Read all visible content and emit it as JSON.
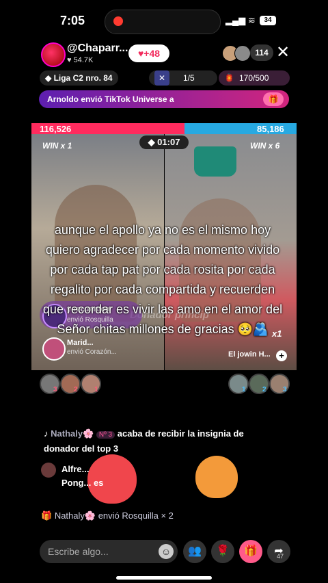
{
  "status": {
    "time": "7:05",
    "battery": "34"
  },
  "host": {
    "name": "@Chaparr...",
    "likes": "54.7K",
    "like_badge": "+48"
  },
  "viewers": {
    "count": "114"
  },
  "league": "Liga C2 nro. 84",
  "rank_progress": "1/5",
  "gift_progress": "170/500",
  "banner": {
    "text": "Arnoldo envió TikTok Universe a"
  },
  "battle": {
    "left_score": "116,526",
    "right_score": "85,186",
    "timer": "01:07",
    "left_win": "WIN x 1",
    "right_win": "WIN x 6",
    "left_fraction": 0.578
  },
  "panels": {
    "left_gift_name": "y recuerden",
    "left_gift_sub": "envió Rosquilla",
    "left_gift2_name": "Marid...",
    "left_gift2_sub": "envió Corazón...",
    "donor_watermark": "Donador princip",
    "multiplier": "x1",
    "right_name": "El jowin H..."
  },
  "caption": "aunque el apollo ya no es el mismo hoy quiero agradecer por cada momento vivido por cada tap pat por cada rosita por cada regalito por cada compartida y recuerden que recordar es vivir las amo en el amor del Señor chitas millones de gracias 🥺🫂",
  "ranks_left": [
    "3",
    "2",
    "1"
  ],
  "ranks_right": [
    "1",
    "2",
    "3"
  ],
  "chat": {
    "msg1_user": "Nathaly🌸",
    "msg1_badge": "Nº 3",
    "msg1_text": "acaba de recibir la insignia de donador del top 3",
    "msg2_user": "Alfre...",
    "msg2_text": "Pong... es",
    "msg3_text": "Nathaly🌸 envió Rosquilla × 2"
  },
  "bottom": {
    "placeholder": "Escribe algo...",
    "share_count": "47"
  }
}
